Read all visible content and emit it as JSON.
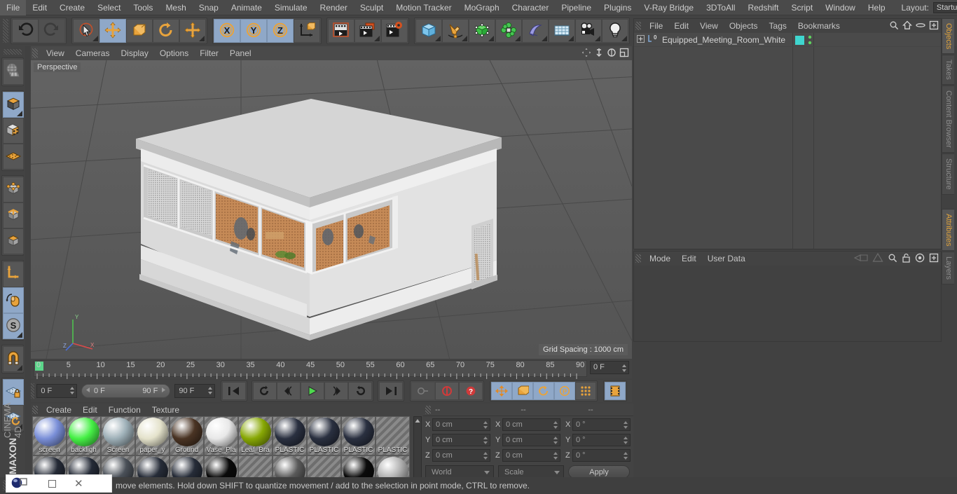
{
  "app": {
    "title": "CINEMA 4D",
    "brand_top": "MAXON",
    "brand_sub": "CINEMA 4D"
  },
  "menubar": {
    "items": [
      "File",
      "Edit",
      "Create",
      "Select",
      "Tools",
      "Mesh",
      "Snap",
      "Animate",
      "Simulate",
      "Render",
      "Sculpt",
      "Motion Tracker",
      "MoGraph",
      "Character",
      "Pipeline",
      "Plugins",
      "V-Ray Bridge",
      "3DToAll",
      "Redshift",
      "Script",
      "Window",
      "Help"
    ],
    "layout_label": "Layout:",
    "layout_value": "Startup",
    "search_icon": "search-icon"
  },
  "toolbar": {
    "groups": [
      {
        "name": "undo-redo",
        "buttons": [
          {
            "name": "undo-button",
            "icon": "undo-icon",
            "selected": false,
            "dim": false
          },
          {
            "name": "redo-button",
            "icon": "redo-icon",
            "selected": false,
            "dim": true
          }
        ]
      },
      {
        "name": "transform-tools",
        "buttons": [
          {
            "name": "live-selection-tool",
            "icon": "cursor-circle-icon",
            "selected": false,
            "corner": true
          },
          {
            "name": "move-tool",
            "icon": "move-arrows-icon",
            "selected": true
          },
          {
            "name": "scale-tool",
            "icon": "scale-box-icon",
            "selected": false
          },
          {
            "name": "rotate-tool",
            "icon": "rotate-icon",
            "selected": false
          },
          {
            "name": "magnet-move-tool",
            "icon": "move-arrows-icon",
            "selected": false,
            "corner": true
          }
        ]
      },
      {
        "name": "axis-locks",
        "buttons": [
          {
            "name": "lock-x-axis-button",
            "icon": "x-axis-icon",
            "label": "X",
            "selected": true
          },
          {
            "name": "lock-y-axis-button",
            "icon": "y-axis-icon",
            "label": "Y",
            "selected": true
          },
          {
            "name": "lock-z-axis-button",
            "icon": "z-axis-icon",
            "label": "Z",
            "selected": true
          },
          {
            "name": "world-object-axis-button",
            "icon": "world-axis-icon",
            "selected": false
          }
        ]
      },
      {
        "name": "render-tools",
        "buttons": [
          {
            "name": "render-view-button",
            "icon": "render-view-icon",
            "selected": false
          },
          {
            "name": "render-region-button",
            "icon": "render-region-icon",
            "selected": false,
            "corner": true
          },
          {
            "name": "render-settings-button",
            "icon": "render-settings-icon",
            "selected": false
          }
        ]
      },
      {
        "name": "create-objects",
        "buttons": [
          {
            "name": "add-cube-button",
            "icon": "cube-icon",
            "selected": false,
            "corner": true
          },
          {
            "name": "add-spline-button",
            "icon": "pen-spline-icon",
            "selected": false,
            "corner": true
          },
          {
            "name": "add-generator-button",
            "icon": "green-cube-icon",
            "selected": false,
            "corner": true
          },
          {
            "name": "add-array-button",
            "icon": "array-icon",
            "selected": false,
            "corner": true
          },
          {
            "name": "add-deformer-button",
            "icon": "bend-deformer-icon",
            "selected": false,
            "corner": true
          },
          {
            "name": "add-scene-object-button",
            "icon": "floor-grid-icon",
            "selected": false,
            "corner": true
          },
          {
            "name": "add-camera-button",
            "icon": "camera-icon",
            "selected": false,
            "corner": true
          },
          {
            "name": "add-light-button",
            "icon": "light-bulb-icon",
            "selected": false,
            "corner": true
          }
        ]
      }
    ]
  },
  "lefttoolbar": {
    "groups": [
      {
        "name": "make-editable-group",
        "buttons": [
          {
            "name": "make-editable-button",
            "icon": "globe-mesh-icon",
            "selected": false
          }
        ]
      },
      {
        "name": "mode-group",
        "buttons": [
          {
            "name": "model-mode-button",
            "icon": "model-cube-icon",
            "selected": true,
            "corner": true
          },
          {
            "name": "texture-mode-button",
            "icon": "texture-cube-icon",
            "selected": false
          },
          {
            "name": "workplane-mode-button",
            "icon": "workplane-icon",
            "selected": false
          }
        ]
      },
      {
        "name": "component-group",
        "buttons": [
          {
            "name": "points-mode-button",
            "icon": "points-cube-icon",
            "selected": false
          },
          {
            "name": "edges-mode-button",
            "icon": "edges-cube-icon",
            "selected": false
          },
          {
            "name": "polygons-mode-button",
            "icon": "polygons-cube-icon",
            "selected": false
          }
        ]
      },
      {
        "name": "axis-group",
        "buttons": [
          {
            "name": "enable-axis-button",
            "icon": "axis-l-icon",
            "selected": false
          },
          {
            "name": "viewport-solo-button",
            "icon": "mouse-icon",
            "selected": true
          },
          {
            "name": "soft-selection-button",
            "icon": "s-sphere-icon",
            "selected": true,
            "corner": true
          }
        ]
      },
      {
        "name": "snap-group",
        "buttons": [
          {
            "name": "enable-snap-button",
            "icon": "magnet-icon",
            "selected": false,
            "corner": true
          }
        ]
      },
      {
        "name": "workplane-group",
        "buttons": [
          {
            "name": "lock-workplane-button",
            "icon": "workplane-lock-icon",
            "selected": true
          },
          {
            "name": "planar-workplane-button",
            "icon": "workplane-rotate-icon",
            "selected": false,
            "corner": true
          }
        ]
      }
    ]
  },
  "viewport": {
    "menu": [
      "View",
      "Cameras",
      "Display",
      "Filter",
      "Options",
      "Panel"
    ],
    "menu_ordered": [
      "View",
      "Cameras",
      "Display",
      "Options",
      "Filter",
      "Panel"
    ],
    "label": "Perspective",
    "grid_spacing": "Grid Spacing : 1000 cm",
    "icons": [
      "pan-icon",
      "dolly-icon",
      "rotate-view-icon",
      "maximize-view-icon"
    ],
    "axis_labels": {
      "y": "Y",
      "x": "X",
      "z": "Z"
    },
    "colors": {
      "bg_top": "#616161",
      "bg_bottom": "#545454",
      "floor": "#595959",
      "grid_line": "#4a4a4a"
    }
  },
  "timeline": {
    "ticks": [
      "0",
      "5",
      "10",
      "15",
      "20",
      "25",
      "30",
      "35",
      "40",
      "45",
      "50",
      "55",
      "60",
      "65",
      "70",
      "75",
      "80",
      "85",
      "90"
    ],
    "current_frame_field": "0 F",
    "playhead_frame": 0
  },
  "transport": {
    "start_field": "0 F",
    "range_min": "0 F",
    "range_max": "90 F",
    "end_field": "90 F",
    "buttons": [
      {
        "name": "go-to-start-button",
        "icon": "skip-start-icon"
      },
      {
        "name": "go-to-previous-key-button",
        "icon": "prev-key-icon"
      },
      {
        "name": "step-back-button",
        "icon": "step-back-icon"
      },
      {
        "name": "play-button",
        "icon": "play-icon"
      },
      {
        "name": "step-forward-button",
        "icon": "step-forward-icon"
      },
      {
        "name": "go-to-next-key-button",
        "icon": "next-key-icon"
      },
      {
        "name": "go-to-end-button",
        "icon": "skip-end-icon"
      },
      {
        "name": "record-keyframe-button",
        "icon": "key-icon"
      },
      {
        "name": "autokeying-button",
        "icon": "autokey-icon"
      },
      {
        "name": "keyframe-selection-button",
        "icon": "question-key-icon"
      },
      {
        "name": "position-key-button",
        "icon": "move-arrows-icon"
      },
      {
        "name": "scale-key-button",
        "icon": "scale-box-icon"
      },
      {
        "name": "rotation-key-button",
        "icon": "rotate-icon"
      },
      {
        "name": "parameter-key-button",
        "icon": "p-circle-icon"
      },
      {
        "name": "point-level-animation-button",
        "icon": "pla-dots-icon"
      },
      {
        "name": "timeline-toggle-button",
        "icon": "filmstrip-icon"
      }
    ]
  },
  "material_manager": {
    "menu": [
      "Create",
      "Edit",
      "Function",
      "Texture"
    ],
    "materials": [
      {
        "name": "screen",
        "label": "screen",
        "color": "#7a8fd8",
        "type": "sphere"
      },
      {
        "name": "backlight",
        "label": "backligh",
        "color": "#46f046",
        "type": "sphere"
      },
      {
        "name": "screen2",
        "label": "Screen",
        "color": "#9eb0b8",
        "type": "sphere"
      },
      {
        "name": "paper_y",
        "label": "paper_y",
        "color": "#e4e2cb",
        "type": "sphere"
      },
      {
        "name": "ground",
        "label": "Ground",
        "color": "#4a3424",
        "type": "sphere"
      },
      {
        "name": "vase_pla",
        "label": "Vase_Pla",
        "color": "#e8e8e8",
        "type": "sphere"
      },
      {
        "name": "leaf_bra",
        "label": "Leaf_Bra",
        "color": "#88a805",
        "type": "sphere"
      },
      {
        "name": "plastic1",
        "label": "PLASTIC",
        "color": "#2a3040",
        "type": "sphere"
      },
      {
        "name": "plastic2",
        "label": "PLASTIC",
        "color": "#2a3040",
        "type": "sphere"
      },
      {
        "name": "plastic3",
        "label": "PLASTIC",
        "color": "#2a3040",
        "type": "sphere"
      },
      {
        "name": "plastic4",
        "label": "PLASTIC",
        "color": "#8a8a8a",
        "type": "empty"
      },
      {
        "name": "mat12",
        "label": "",
        "color": "#242a36",
        "type": "sphere"
      },
      {
        "name": "mat13",
        "label": "",
        "color": "#242a36",
        "type": "sphere"
      },
      {
        "name": "mat14",
        "label": "",
        "color": "#4a5058",
        "type": "sphere"
      },
      {
        "name": "mat15",
        "label": "",
        "color": "#262c38",
        "type": "sphere"
      },
      {
        "name": "mat16",
        "label": "",
        "color": "#262c38",
        "type": "sphere"
      },
      {
        "name": "mat17",
        "label": "",
        "color": "#0a0a0a",
        "type": "sphere"
      },
      {
        "name": "mat18",
        "label": "",
        "color": "#8a8a8a",
        "type": "empty"
      },
      {
        "name": "mat19",
        "label": "",
        "color": "#5a5a5a",
        "type": "sphere"
      },
      {
        "name": "mat20",
        "label": "",
        "color": "#8a8a8a",
        "type": "empty"
      },
      {
        "name": "mat21",
        "label": "",
        "color": "#0a0a0a",
        "type": "sphere"
      },
      {
        "name": "mat22",
        "label": "",
        "color": "#b0b0b0",
        "type": "sphere"
      }
    ]
  },
  "coordinates": {
    "header": [
      "--",
      "--",
      "--"
    ],
    "rows": [
      {
        "axis": "X",
        "position": "0 cm",
        "size": "0 cm",
        "rotation": "0 °"
      },
      {
        "axis": "Y",
        "position": "0 cm",
        "size": "0 cm",
        "rotation": "0 °"
      },
      {
        "axis": "Z",
        "position": "0 cm",
        "size": "0 cm",
        "rotation": "0 °"
      }
    ],
    "space_select": "World",
    "mode_select": "Scale",
    "apply_label": "Apply"
  },
  "object_manager": {
    "menu": [
      "File",
      "Edit",
      "View",
      "Objects",
      "Tags",
      "Bookmarks"
    ],
    "icons": [
      "search-icon",
      "home-icon",
      "ellipse-icon",
      "expand-icon"
    ],
    "objects": [
      {
        "name": "Equipped_Meeting_Room_White",
        "layer_badge": "0",
        "tag_color": "#3fd6cf",
        "expandable": true
      }
    ]
  },
  "attribute_manager": {
    "menu": [
      "Mode",
      "Edit",
      "User Data"
    ],
    "icons": [
      "prev-nav-icon",
      "next-nav-icon",
      "search-icon",
      "lock-icon",
      "target-icon",
      "expand-icon"
    ],
    "content": ""
  },
  "right_tabs": {
    "top": [
      {
        "label": "Objects",
        "active": true
      },
      {
        "label": "Takes",
        "active": false
      },
      {
        "label": "Content Browser",
        "active": false
      },
      {
        "label": "Structure",
        "active": false
      }
    ],
    "bottom": [
      {
        "label": "Attributes",
        "active": true
      },
      {
        "label": "Layers",
        "active": false
      }
    ]
  },
  "statusbar": {
    "text": "move elements. Hold down SHIFT to quantize movement / add to the selection in point mode, CTRL to remove."
  },
  "taskbar_popup": {
    "app_icon": "c4d-app-icon",
    "restore_icon": "restore-window-icon",
    "maximize_icon": "maximize-window-icon",
    "close_icon": "close-window-icon"
  }
}
